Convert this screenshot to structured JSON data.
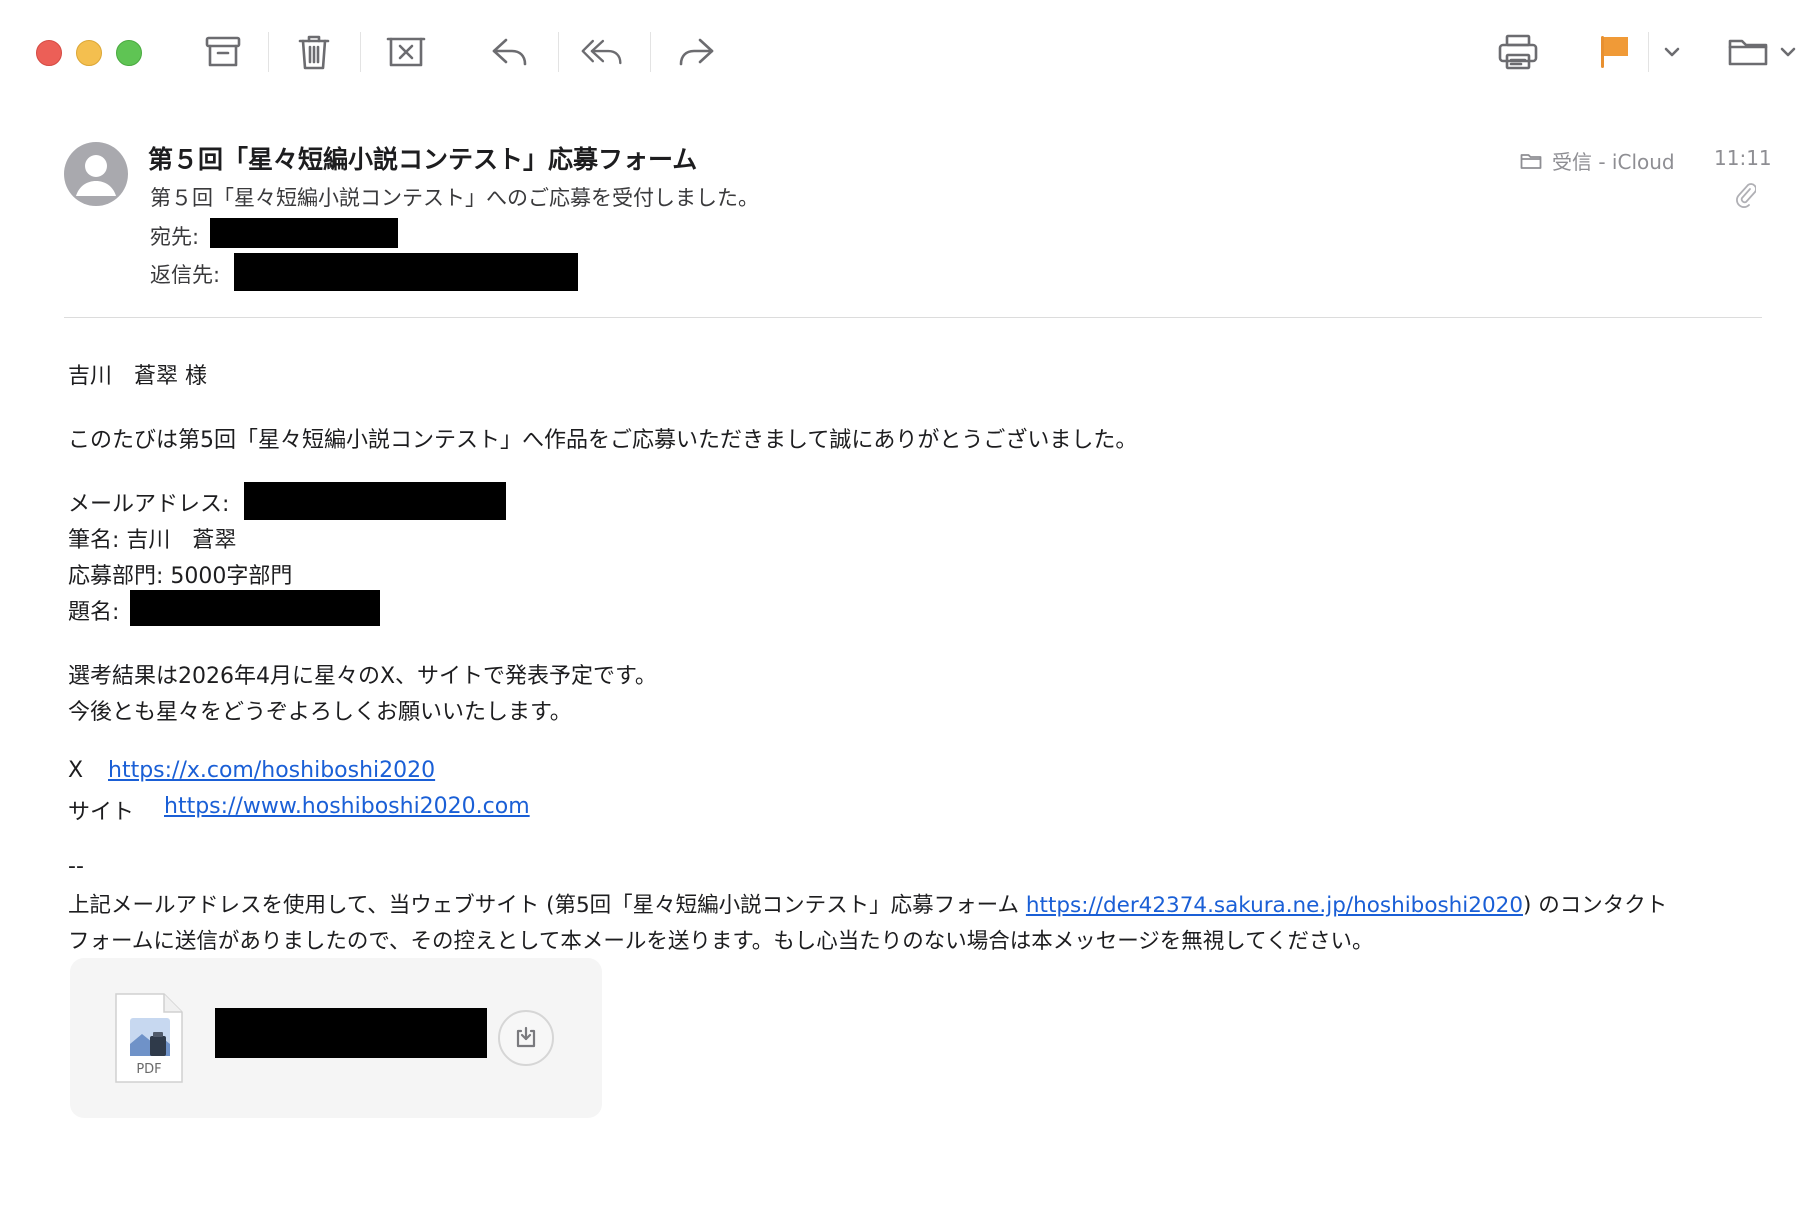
{
  "toolbar": {
    "buttons": [
      "archive-icon",
      "trash-icon",
      "junk-icon",
      "reply-icon",
      "reply-all-icon",
      "forward-icon",
      "print-icon",
      "flag-icon",
      "flag-menu-chevron-icon",
      "move-folder-icon",
      "folder-menu-chevron-icon"
    ],
    "flag_color": "#f09a37"
  },
  "header": {
    "subject": "第５回「星々短編小説コンテスト」応募フォーム",
    "preview": "第５回「星々短編小説コンテスト」へのご応募を受付しました。",
    "to_label": "宛先:",
    "reply_to_label": "返信先:",
    "mailbox": "受信 - iCloud",
    "time": "11:11"
  },
  "body": {
    "greeting": "吉川　蒼翠 様",
    "thanks": "このたびは第5回「星々短編小説コンテスト」へ作品をご応募いただきまして誠にありがとうございました。",
    "email_label": "メールアドレス:",
    "pen_name": "筆名: 吉川　蒼翠",
    "category": "応募部門: 5000字部門",
    "title_label": "題名:",
    "result_notice": "選考結果は2026年4月に星々のX、サイトで発表予定です。",
    "closing": "今後とも星々をどうぞよろしくお願いいたします。",
    "x_label": "X",
    "x_url": "https://x.com/hoshiboshi2020",
    "site_label": "サイト",
    "site_url": "https://www.hoshiboshi2020.com",
    "sig_sep": "--",
    "footer_pre": "上記メールアドレスを使用して、当ウェブサイト (第5回「星々短編小説コンテスト」応募フォーム",
    "footer_url": "https://der42374.sakura.ne.jp/hoshiboshi2020",
    "footer_post": ") のコンタクト",
    "footer_line2": "フォームに送信がありましたので、その控えとして本メールを送ります。もし心当たりのない場合は本メッセージを無視してください。"
  },
  "attachment": {
    "type_label": "PDF"
  }
}
